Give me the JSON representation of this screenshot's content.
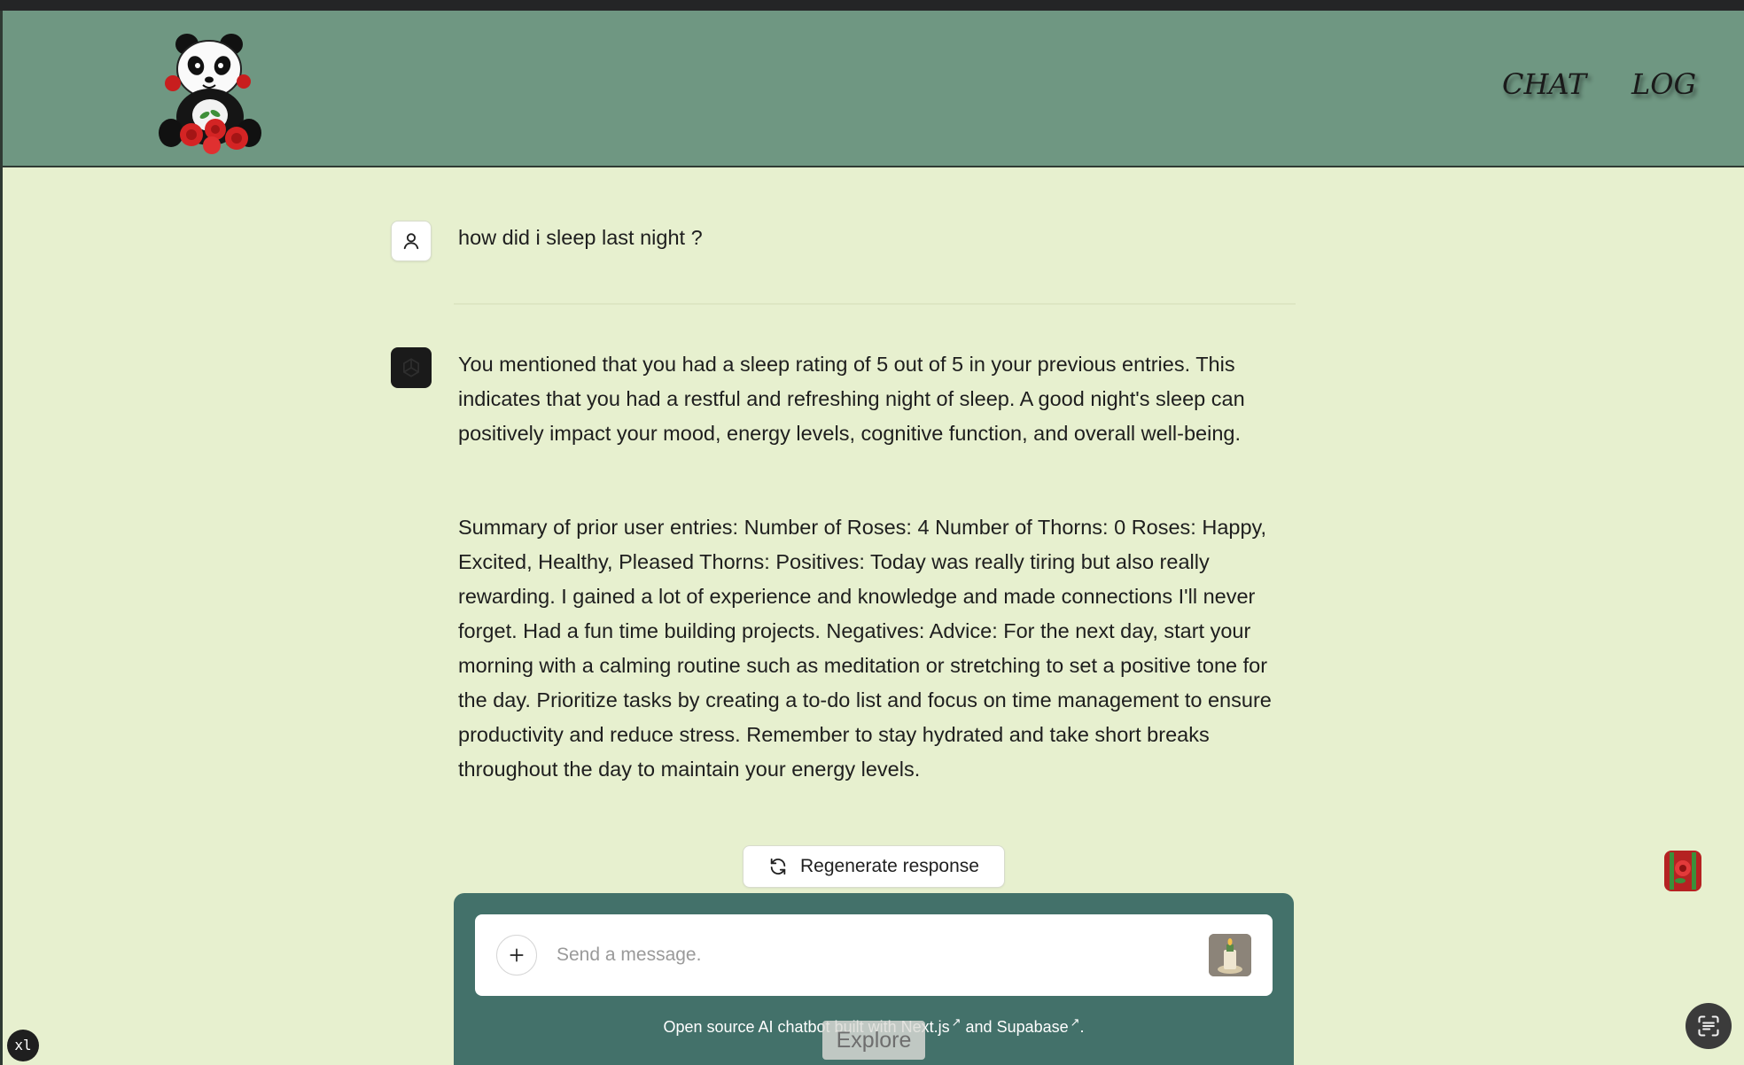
{
  "header": {
    "nav": {
      "chat_label": "CHAT",
      "log_label": "LOG"
    }
  },
  "conversation": {
    "user_message": "how did i sleep last night ?",
    "assistant_paragraphs": [
      "You mentioned that you had a sleep rating of 5 out of 5 in your previous entries. This indicates that you had a restful and refreshing night of sleep. A good night's sleep can positively impact your mood, energy levels, cognitive function, and overall well-being.",
      "Summary of prior user entries: Number of Roses: 4 Number of Thorns: 0 Roses: Happy, Excited, Healthy, Pleased Thorns: Positives: Today was really tiring but also really rewarding. I gained a lot of experience and knowledge and made connections I'll never forget. Had a fun time building projects. Negatives: Advice: For the next day, start your morning with a calming routine such as meditation or stretching to set a positive tone for the day. Prioritize tasks by creating a to-do list and focus on time management to ensure productivity and reduce stress. Remember to stay hydrated and take short breaks throughout the day to maintain your energy levels."
    ]
  },
  "actions": {
    "regenerate_label": "Regenerate response",
    "explore_label": "Explore"
  },
  "composer": {
    "placeholder": "Send a message."
  },
  "footer": {
    "prefix": "Open source AI chatbot built with ",
    "nextjs_link": "Next.js",
    "middle": " and ",
    "supabase_link": "Supabase",
    "suffix": ".",
    "external_glyph": "↗"
  },
  "badges": {
    "xl": "xl"
  },
  "icons": {
    "logo": "panda-with-roses-logo",
    "user_avatar": "user-icon",
    "bot_avatar": "openai-icon",
    "regenerate": "refresh-icon",
    "plus": "plus-icon",
    "send": "candle-send-icon",
    "widget": "bamboo-rose-widget-icon",
    "scan": "scan-text-icon"
  },
  "colors": {
    "header_bg": "#6f9782",
    "page_bg": "#e7f0cf",
    "composer_panel": "#43716a",
    "bot_avatar_bg": "#1a1a1a"
  }
}
